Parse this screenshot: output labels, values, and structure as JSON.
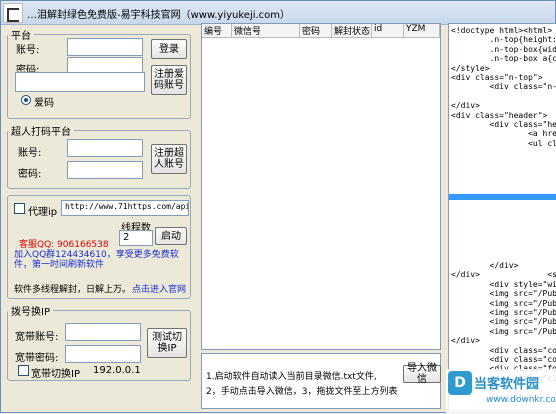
{
  "window": {
    "title": "…泪解封绿色免费版-易宇科技官网（www.yiyukeji.com）"
  },
  "login": {
    "group_label": "平台",
    "account_label": "账号:",
    "password_label": "密码:",
    "login_button": "登录",
    "register_button": "注册爱码账号",
    "radio_label": "爱码"
  },
  "chaoren": {
    "group_label": "超人打码平台",
    "account_label": "账号:",
    "password_label": "密码:",
    "register_button": "注册超人账号"
  },
  "proxy": {
    "checkbox_label": "代理ip",
    "url_value": "http://www.71https.com/api.asp?1",
    "threads_label": "线程数",
    "threads_value": "2",
    "start_button": "启动",
    "qq_text": "客服QQ: 906166538",
    "group_text": "加入QQ群124434610，享受更多免费软件，第一时间刷新软件",
    "speed_text": "软件多线程解封，日解上万。",
    "official_link": "点击进入官网"
  },
  "dial": {
    "group_label": "拨号换IP",
    "account_label": "宽带账号:",
    "password_label": "宽带密码:",
    "test_button": "测试切换IP",
    "checkbox_label": "宽带切换IP",
    "ip_value": "192.0.0.1"
  },
  "table": {
    "columns": [
      "编号",
      "微信号",
      "密码",
      "解封状态",
      "id",
      "YZM"
    ]
  },
  "messages": {
    "line1": "1.启动软件自动读入当前目录微信.txt文件,",
    "line2": "2，手动点击导入微信，3，拖拢文件至上方列表",
    "import_button": "导入微信"
  },
  "code_lines": [
    "<!doctype html><html>  <",
    "        .n-top{height: 30",
    "        .n-top-box{width:",
    "        .n-top-box a{colo",
    "</style>",
    "<div class=\"n-top\">",
    "        <div class=\"n-t",
    "",
    "</div>",
    "<div class=\"header\">",
    "        <div class=\"heade",
    "                <a href=\"",
    "                <ul class",
    "",
    "",
    "",
    "",
    "",
    "",
    "",
    "",
    "",
    "",
    "",
    "",
    "        </div>",
    "</div>              <style>",
    "        <div style=\"width",
    "        <img src=\"/Publi",
    "        <img src=\"/Publi",
    "        <img src=\"/Publi",
    "        <img src=\"/Publi",
    "        <img src=\"/Publi",
    "</div>",
    "        <div class=\"containe",
    "        <div class=\"copy",
    "        <div class=\"foot",
    "        <div style=\"clea",
    "</div>",
    "        <script t"
  ],
  "watermark": {
    "title": "当客软件园",
    "url": "www.downkr.com",
    "logo": "D"
  }
}
